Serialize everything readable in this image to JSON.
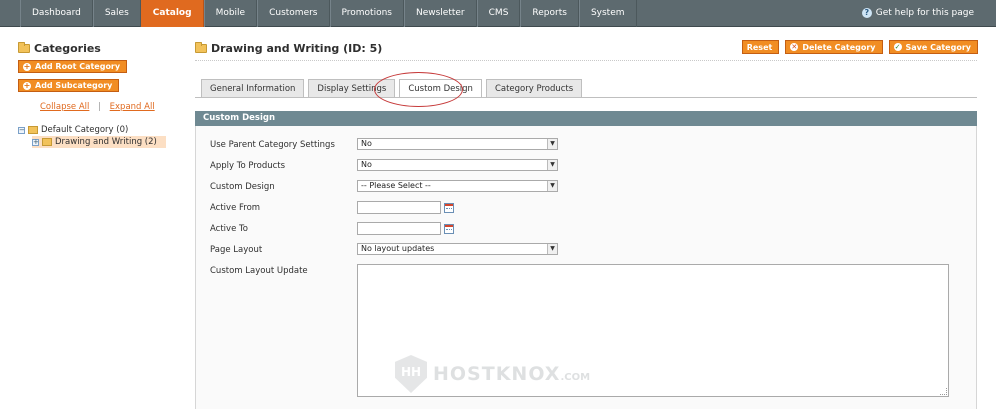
{
  "nav": {
    "items": [
      "Dashboard",
      "Sales",
      "Catalog",
      "Mobile",
      "Customers",
      "Promotions",
      "Newsletter",
      "CMS",
      "Reports",
      "System"
    ],
    "active": "Catalog",
    "help": "Get help for this page"
  },
  "sidebar": {
    "title": "Categories",
    "add_root": "Add Root Category",
    "add_sub": "Add Subcategory",
    "collapse": "Collapse All",
    "separator": "|",
    "expand": "Expand All",
    "tree": [
      {
        "label": "Default Category (0)"
      },
      {
        "label": "Drawing and Writing (2)"
      }
    ]
  },
  "main": {
    "title": "Drawing and Writing (ID: 5)",
    "reset": "Reset",
    "delete": "Delete Category",
    "save": "Save Category",
    "tabs": [
      {
        "label": "General Information"
      },
      {
        "label": "Display Settings"
      },
      {
        "label": "Custom Design"
      },
      {
        "label": "Category Products"
      }
    ],
    "active_tab": "Custom Design",
    "panel_title": "Custom Design",
    "fields": {
      "use_parent": {
        "label": "Use Parent Category Settings",
        "value": "No"
      },
      "apply_products": {
        "label": "Apply To Products",
        "value": "No"
      },
      "custom_design": {
        "label": "Custom Design",
        "value": "-- Please Select --"
      },
      "active_from": {
        "label": "Active From",
        "value": ""
      },
      "active_to": {
        "label": "Active To",
        "value": ""
      },
      "page_layout": {
        "label": "Page Layout",
        "value": "No layout updates"
      },
      "layout_update": {
        "label": "Custom Layout Update",
        "value": ""
      }
    }
  },
  "watermark": {
    "badge": "HH",
    "text": "HOSTKNOX",
    "suffix": ".COM"
  },
  "colors": {
    "accent": "#e06a1f",
    "nav_bg": "#5d6a6f",
    "panel_head": "#6f8992",
    "annotation": "#c63a3a"
  }
}
